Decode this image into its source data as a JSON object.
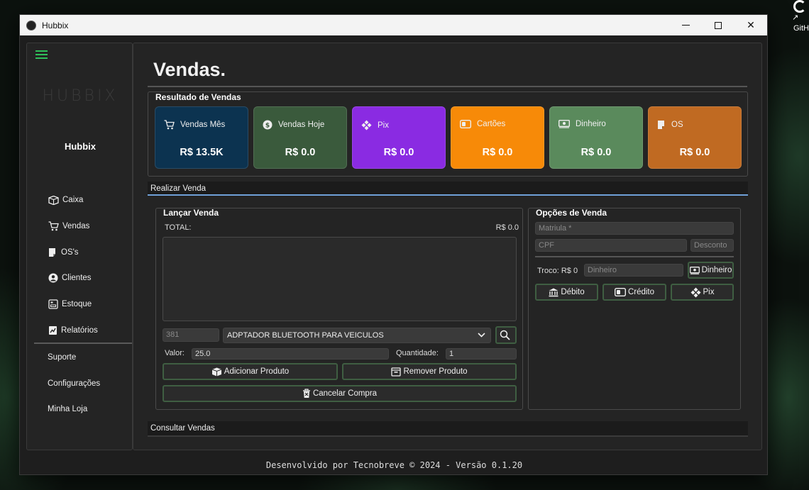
{
  "window": {
    "title": "Hubbix"
  },
  "desktop": {
    "icon_label": "GitH"
  },
  "sidebar": {
    "logo": "HUBBIX",
    "brand": "Hubbix",
    "items": [
      {
        "label": "Caixa",
        "icon": "box-icon"
      },
      {
        "label": "Vendas",
        "icon": "cart-icon"
      },
      {
        "label": "OS's",
        "icon": "document-icon"
      },
      {
        "label": "Clientes",
        "icon": "user-icon"
      },
      {
        "label": "Estoque",
        "icon": "inventory-icon"
      },
      {
        "label": "Relatórios",
        "icon": "report-icon"
      }
    ],
    "bottom_items": [
      "Suporte",
      "Configurações",
      "Minha Loja"
    ]
  },
  "main": {
    "title": "Vendas.",
    "results": {
      "title": "Resultado de Vendas",
      "cards": [
        {
          "label": "Vendas Mês",
          "value": "R$ 13.5K",
          "color": "#0c3350",
          "icon": "cart-icon"
        },
        {
          "label": "Vendas Hoje",
          "value": "R$ 0.0",
          "color": "#3a5a3c",
          "icon": "money-circle-icon"
        },
        {
          "label": "Pix",
          "value": "R$ 0.0",
          "color": "#8a2be2",
          "icon": "pix-icon"
        },
        {
          "label": "Cartões",
          "value": "R$ 0.0",
          "color": "#f78a08",
          "icon": "card-icon"
        },
        {
          "label": "Dinheiro",
          "value": "R$ 0.0",
          "color": "#5a8a5c",
          "icon": "cash-icon"
        },
        {
          "label": "OS",
          "value": "R$ 0.0",
          "color": "#c06a22",
          "icon": "document-icon"
        }
      ]
    },
    "realizar": {
      "title": "Realizar Venda"
    },
    "lancar": {
      "title": "Lançar Venda",
      "total_label": "TOTAL:",
      "total_value": "R$ 0.0",
      "code_value": "381",
      "product": "ADPTADOR BLUETOOTH PARA VEICULOS",
      "valor_label": "Valor:",
      "valor_value": "25.0",
      "quantidade_label": "Quantidade:",
      "quantidade_value": "1",
      "add_button": "Adicionar Produto",
      "remove_button": "Remover Produto",
      "cancel_button": "Cancelar Compra"
    },
    "opcoes": {
      "title": "Opções de Venda",
      "matricula_placeholder": "Matriula *",
      "cpf_placeholder": "CPF",
      "desconto_placeholder": "Desconto",
      "troco_label": "Troco: R$ 0",
      "dinheiro_placeholder": "Dinheiro",
      "dinheiro_button": "Dinheiro",
      "debito_button": "Débito",
      "credito_button": "Crédito",
      "pix_button": "Pix"
    },
    "consultar": {
      "title": "Consultar Vendas"
    }
  },
  "footer": "Desenvolvido por Tecnobreve © 2024 - Versão 0.1.20",
  "colors": {
    "accent_green": "#2fc15a",
    "tab_underline": "#6fa0d8",
    "button_border": "#3f5e42"
  }
}
